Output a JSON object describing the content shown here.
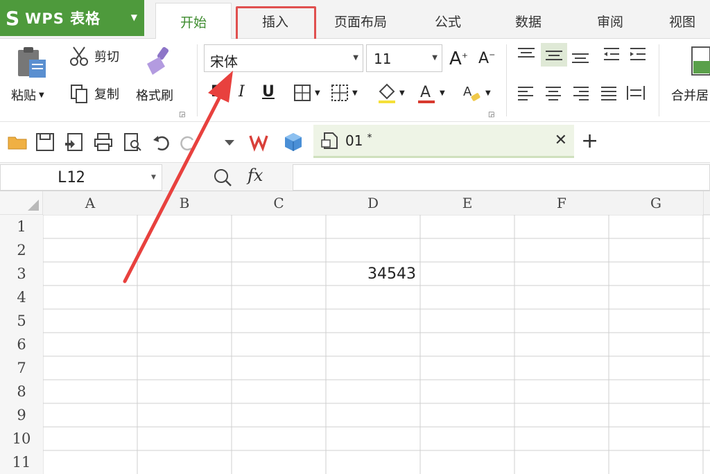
{
  "app": {
    "name": "WPS 表格"
  },
  "menu": {
    "tabs": [
      {
        "label": "开始",
        "active": true
      },
      {
        "label": "插入",
        "active": false
      },
      {
        "label": "页面布局",
        "active": false
      },
      {
        "label": "公式",
        "active": false
      },
      {
        "label": "数据",
        "active": false
      },
      {
        "label": "审阅",
        "active": false
      },
      {
        "label": "视图",
        "active": false
      }
    ]
  },
  "ribbon": {
    "paste_label": "粘贴",
    "cut_label": "剪切",
    "copy_label": "复制",
    "format_painter_label": "格式刷",
    "font_name": "宋体",
    "font_size": "11",
    "bold_label": "B",
    "italic_label": "I",
    "underline_label": "U",
    "merge_label": "合并居"
  },
  "document": {
    "tab_name": "01",
    "modified_mark": "*"
  },
  "formula_bar": {
    "cell_ref": "L12",
    "fx_label": "fx",
    "formula": ""
  },
  "sheet": {
    "columns": [
      "A",
      "B",
      "C",
      "D",
      "E",
      "F",
      "G"
    ],
    "rows": [
      "1",
      "2",
      "3",
      "4",
      "5",
      "6",
      "7",
      "8",
      "9",
      "10",
      "11"
    ],
    "cells": [
      {
        "ref": "D3",
        "value": "34543"
      }
    ]
  },
  "colors": {
    "brand": "#4e9a3c",
    "active_tab_text": "#3e8c2f",
    "highlight": "#e0504f",
    "annotation_arrow": "#e8413e"
  }
}
